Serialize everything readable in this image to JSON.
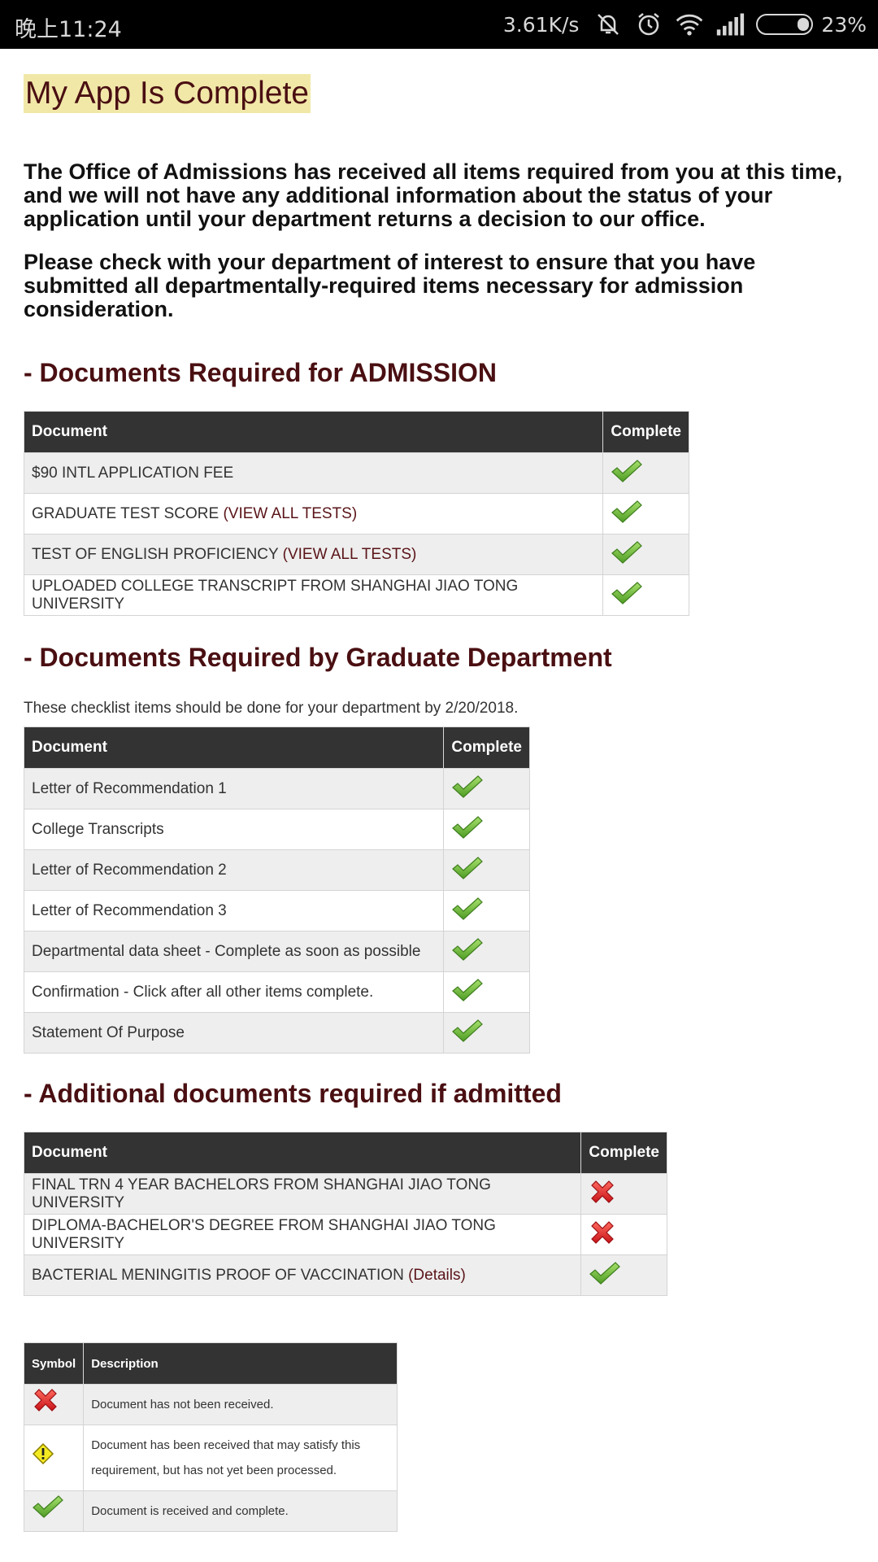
{
  "status_bar": {
    "time": "晚上11:24",
    "speed": "3.61K/s",
    "battery": "23%",
    "icons": [
      "mute-icon",
      "alarm-icon",
      "wifi-icon",
      "signal-icon",
      "battery-icon"
    ]
  },
  "page": {
    "title": "My App Is Complete",
    "intro_1": "The Office of Admissions has received all items required from you at this time, and we will not have any additional information about the status of your application until your department returns a decision to our office.",
    "intro_2": "Please check with your department of interest to ensure that you have submitted all departmentally-required items necessary for admission consideration."
  },
  "admission": {
    "heading": "- Documents Required for ADMISSION",
    "col_document": "Document",
    "col_complete": "Complete",
    "rows": [
      {
        "text": "$90 INTL APPLICATION FEE",
        "link": "",
        "status": "complete"
      },
      {
        "text": "GRADUATE TEST SCORE",
        "link": "(VIEW ALL TESTS)",
        "status": "complete"
      },
      {
        "text": "TEST OF ENGLISH PROFICIENCY",
        "link": "(VIEW ALL TESTS)",
        "status": "complete"
      },
      {
        "text": "UPLOADED COLLEGE TRANSCRIPT FROM SHANGHAI JIAO TONG UNIVERSITY",
        "link": "",
        "status": "complete"
      }
    ]
  },
  "department": {
    "heading": "- Documents Required by Graduate Department",
    "note": "These checklist items should be done for your department by 2/20/2018.",
    "col_document": "Document",
    "col_complete": "Complete",
    "rows": [
      {
        "text": "Letter of Recommendation 1",
        "status": "complete"
      },
      {
        "text": "College Transcripts",
        "status": "complete"
      },
      {
        "text": "Letter of Recommendation 2",
        "status": "complete"
      },
      {
        "text": "Letter of Recommendation 3",
        "status": "complete"
      },
      {
        "text": "Departmental data sheet - Complete as soon as possible",
        "status": "complete"
      },
      {
        "text": "Confirmation - Click after all other items complete.",
        "status": "complete"
      },
      {
        "text": "Statement Of Purpose",
        "status": "complete"
      }
    ]
  },
  "additional": {
    "heading": "- Additional documents required if admitted",
    "col_document": "Document",
    "col_complete": "Complete",
    "rows": [
      {
        "text": "FINAL TRN 4 YEAR BACHELORS FROM SHANGHAI JIAO TONG UNIVERSITY",
        "link": "",
        "status": "missing"
      },
      {
        "text": "DIPLOMA-BACHELOR'S DEGREE FROM SHANGHAI JIAO TONG UNIVERSITY",
        "link": "",
        "status": "missing"
      },
      {
        "text": "BACTERIAL MENINGITIS PROOF OF VACCINATION",
        "link": "(Details)",
        "status": "complete"
      }
    ]
  },
  "legend": {
    "col_symbol": "Symbol",
    "col_description": "Description",
    "rows": [
      {
        "symbol": "missing",
        "description": "Document has not been received."
      },
      {
        "symbol": "pending",
        "description": "Document has been received that may satisfy this requirement, but has not yet been processed."
      },
      {
        "symbol": "complete",
        "description": "Document is received and complete."
      }
    ]
  },
  "colors": {
    "heading": "#4a0f12",
    "title_highlight": "#f1e8a8",
    "table_header": "#333333",
    "check_green": "#6cbf3a",
    "cross_red": "#e3262d"
  }
}
